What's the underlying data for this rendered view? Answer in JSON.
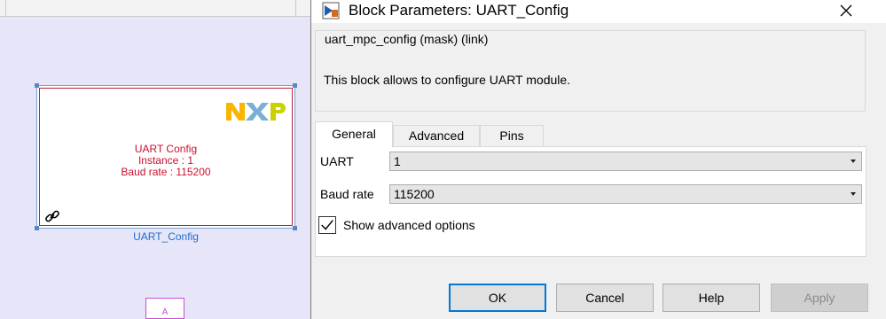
{
  "canvas": {
    "block": {
      "lines": [
        "UART Config",
        "Instance : 1",
        "Baud rate : 115200"
      ],
      "name": "UART_Config",
      "logo": "NXP"
    },
    "small_block_label": "A"
  },
  "dialog": {
    "title": "Block Parameters: UART_Config",
    "mask_title": "uart_mpc_config (mask) (link)",
    "description": "This block allows to configure UART module.",
    "tabs": [
      "General",
      "Advanced",
      "Pins"
    ],
    "active_tab": "General",
    "fields": {
      "uart": {
        "label": "UART",
        "value": "1"
      },
      "baud": {
        "label": "Baud rate",
        "value": "115200"
      }
    },
    "show_advanced": {
      "label": "Show advanced options",
      "checked": true
    },
    "buttons": {
      "ok": "OK",
      "cancel": "Cancel",
      "help": "Help",
      "apply": "Apply"
    }
  },
  "colors": {
    "canvas_bg": "#e6e6f8",
    "block_border": "#c0203b",
    "block_text": "#c8102e",
    "block_name": "#1a6fd1",
    "accent": "#0078d7"
  }
}
